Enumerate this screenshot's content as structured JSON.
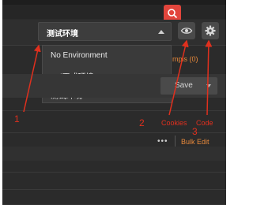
{
  "environment": {
    "selected_label": "测试环境",
    "options": [
      "No Environment",
      "prd正式环境",
      "测试环境"
    ]
  },
  "examples_label": "mpls (0)",
  "save_label": "Save",
  "more_label": "•••",
  "bulk_edit_label": "Bulk Edit",
  "annotations": {
    "num1": "1",
    "num2": "2",
    "num3": "3",
    "cookies": "Cookies",
    "code": "Code"
  },
  "colors": {
    "accent_orange": "#e8893b",
    "annotation_red": "#e0301e",
    "search_button_red": "#e2453c"
  },
  "icons": [
    "search-icon",
    "eye-icon",
    "gear-icon",
    "caret-up-icon",
    "caret-down-icon"
  ]
}
